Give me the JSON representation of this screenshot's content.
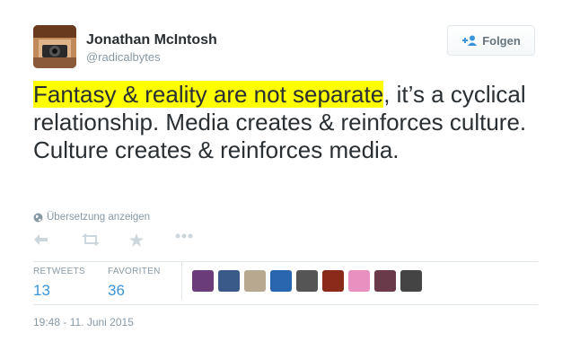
{
  "author": {
    "name": "Jonathan McIntosh",
    "handle": "@radicalbytes"
  },
  "follow_button": {
    "label": "Folgen",
    "icon": "add-user-icon"
  },
  "tweet": {
    "highlighted_text": "Fantasy & reality are not separate",
    "rest_text": ", it’s a cyclical relationship. Media creates & reinforces culture. Culture creates & reinforces media."
  },
  "translate_link": {
    "label": "Übersetzung anzeigen",
    "icon": "globe-icon"
  },
  "actions": [
    "reply-icon",
    "retweet-icon",
    "favorite-icon",
    "more-icon"
  ],
  "stats": {
    "retweets": {
      "label": "RETWEETS",
      "value": "13"
    },
    "favorites": {
      "label": "FAVORITEN",
      "value": "36"
    }
  },
  "favoriter_avatar_colors": [
    "#6a3d7a",
    "#3a5a8a",
    "#b8a890",
    "#2a66b0",
    "#555555",
    "#8a2a1a",
    "#e890c0",
    "#6a3a4a",
    "#444444"
  ],
  "timestamp": "19:48 - 11. Juni 2015",
  "colors": {
    "link_blue": "#3b94d9",
    "highlight": "#ffff00",
    "muted": "#8899a6"
  }
}
